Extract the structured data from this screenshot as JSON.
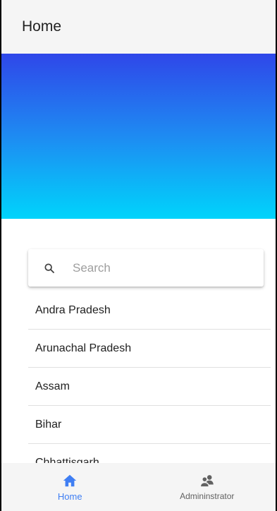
{
  "app_bar": {
    "title": "Home"
  },
  "search": {
    "placeholder": "Search",
    "value": ""
  },
  "states": [
    "Andra Pradesh",
    "Arunachal Pradesh",
    "Assam",
    "Bihar",
    "Chhattisgarh"
  ],
  "bottom_nav": {
    "tabs": [
      {
        "label": "Home",
        "icon": "home-icon",
        "active": true
      },
      {
        "label": "Admininstrator",
        "icon": "users-icon",
        "active": false
      }
    ]
  },
  "colors": {
    "accent": "#3f7ef3",
    "banner_top": "#2f47e9",
    "banner_bottom": "#00d4fb",
    "inactive_icon": "#616161"
  }
}
